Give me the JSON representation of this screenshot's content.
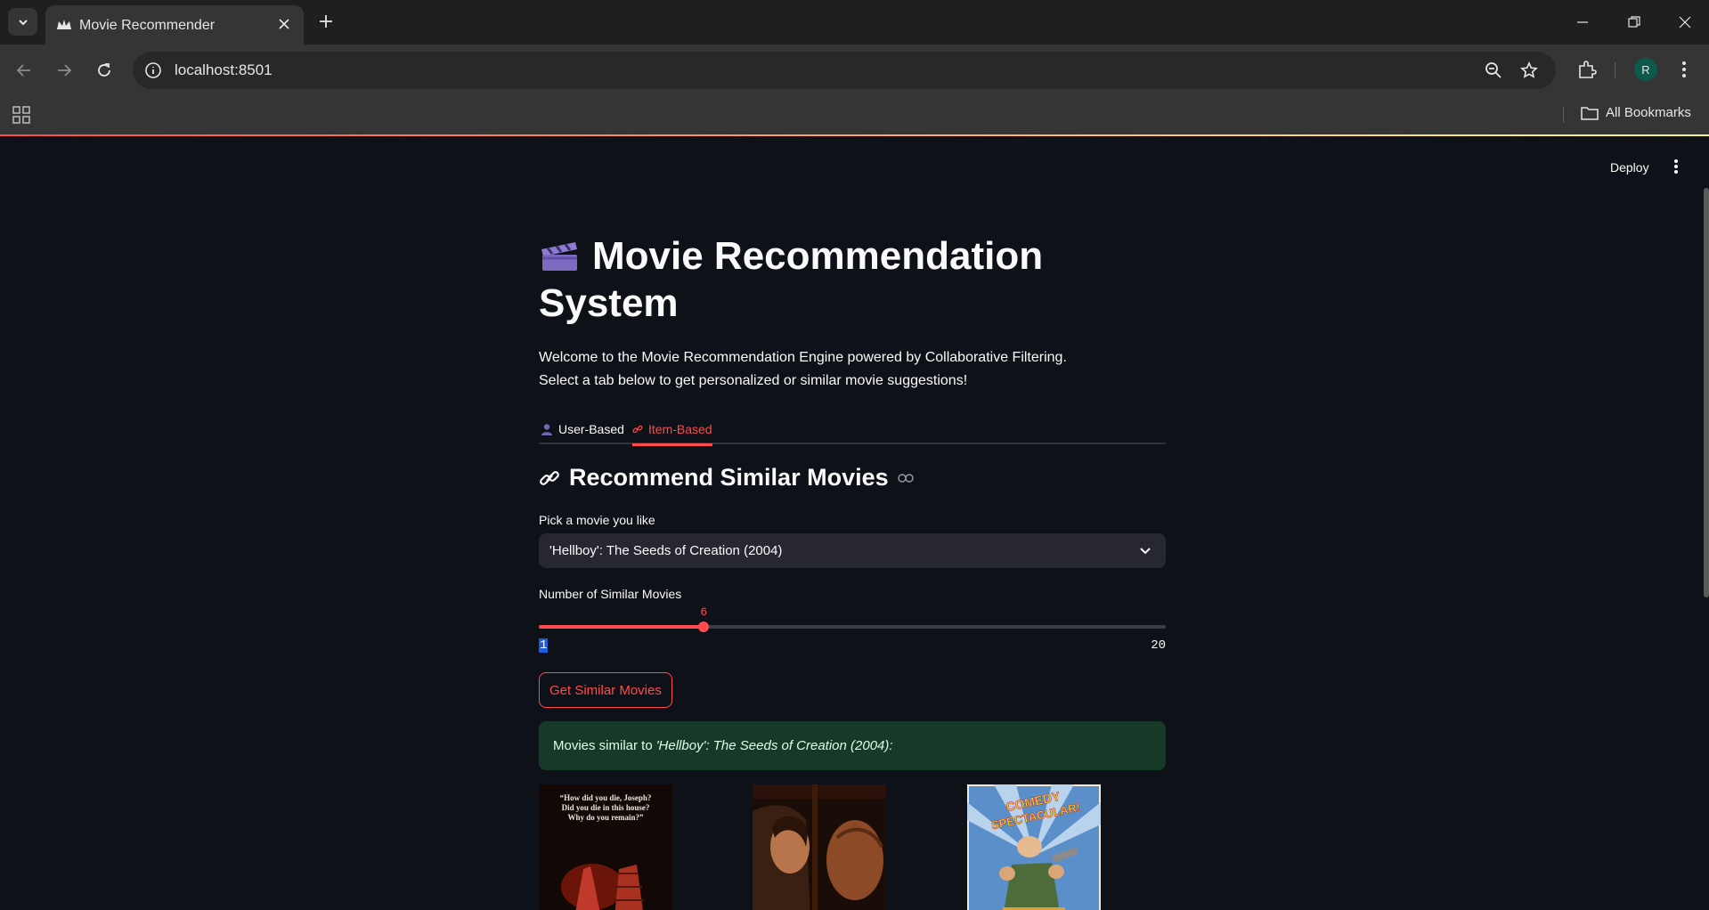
{
  "browser": {
    "tab_title": "Movie Recommender",
    "url": "localhost:8501",
    "profile_initial": "R",
    "bookmarks_label": "All Bookmarks"
  },
  "app": {
    "deploy_label": "Deploy",
    "title": "Movie Recommendation System",
    "intro_line1": "Welcome to the Movie Recommendation Engine powered by Collaborative Filtering.",
    "intro_line2": "Select a tab below to get personalized or similar movie suggestions!",
    "tabs": [
      {
        "label": "User-Based",
        "icon": "user-icon",
        "active": false
      },
      {
        "label": "Item-Based",
        "icon": "link-icon",
        "active": true
      }
    ],
    "subheader": "Recommend Similar Movies",
    "movie_select": {
      "label": "Pick a movie you like",
      "value": "'Hellboy': The Seeds of Creation (2004)"
    },
    "slider": {
      "label": "Number of Similar Movies",
      "value": 6,
      "min": 1,
      "max": 20
    },
    "button_label": "Get Similar Movies",
    "result": {
      "prefix": "Movies similar to",
      "movie": "'Hellboy': The Seeds of Creation (2004):"
    },
    "posters": [
      {
        "name": "poster-1",
        "tagline": "“How did you die, Joseph? Did you die in this house? Why do you remain?”"
      },
      {
        "name": "poster-2",
        "tagline": ""
      },
      {
        "name": "poster-3",
        "tagline": "COMEDY SPECTACULAR!"
      }
    ]
  },
  "colors": {
    "accent": "#ff4b4b",
    "background": "#0e1117",
    "success_bg": "#173928"
  }
}
